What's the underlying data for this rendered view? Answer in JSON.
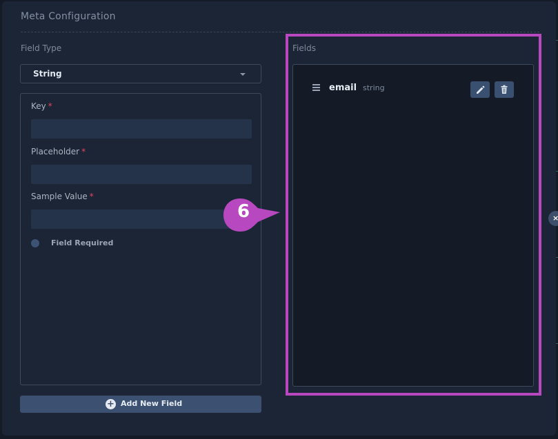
{
  "panel": {
    "title": "Meta Configuration"
  },
  "field_type": {
    "label": "Field Type",
    "selected": "String"
  },
  "form": {
    "key_label": "Key",
    "placeholder_label": "Placeholder",
    "sample_value_label": "Sample Value",
    "required_marker": "*",
    "field_required_label": "Field Required"
  },
  "add_button": {
    "label": "Add New Field"
  },
  "fields": {
    "label": "Fields",
    "items": [
      {
        "name": "email",
        "type": "string"
      }
    ]
  },
  "callout": {
    "number": "6",
    "color": "#b748bf"
  },
  "icons": [
    "chevron-down-icon",
    "drag-handle-icon",
    "pencil-icon",
    "trash-icon",
    "plus-circle-icon",
    "close-icon"
  ],
  "colors": {
    "accent": "#b748bf",
    "required": "#e0475b",
    "button": "#3c5171"
  }
}
